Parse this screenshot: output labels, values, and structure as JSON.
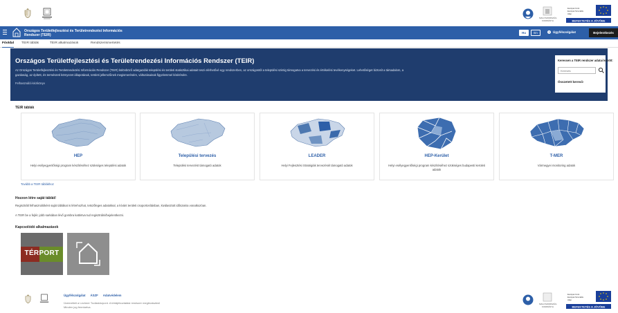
{
  "header": {
    "ministry_logo_text": "MINISZTÉRIUM",
    "eu_partner_text": "MAGYARORSZÁG KORMÁNYA",
    "eu_flag_text": "Európai Unió Európai Szociális Alap",
    "eu_slogan": "BEFEKTETÉS A JÖVŐBE"
  },
  "titlebar": {
    "app_title_line1": "Országos Területfejlesztési és Területrendezési Információs",
    "app_title_line2": "Rendszer (TEIR)",
    "lang_hu": "Hu",
    "lang_en": "En",
    "help_label": "Ügyfélszolgálat",
    "login_label": "Bejelentkezés",
    "accent_color": "#2d5fa8"
  },
  "nav": {
    "tabs": [
      {
        "label": "Főoldal",
        "active": true
      },
      {
        "label": "TEIR táblák",
        "active": false
      },
      {
        "label": "TEIR alkalmazások",
        "active": false
      },
      {
        "label": "Rendszerismertetés",
        "active": false
      }
    ]
  },
  "hero": {
    "title": "Országos Területfejlesztési és Területrendezési Információs Rendszer (TEIR)",
    "desc_line1": "Az Országos Területfejlesztési és Területrendezési Információs Rendszer (TEIR) különböző adatgazdák települési és területi statisztikai adatait teszi elérhetővé egy rendszerben, az országostól a települési szintig támogatva a tervezési és értékelési tevékenységeket. Lehetőséget biztosít a társadalom, a",
    "desc_line2": "gazdaság, az épített, és természeti környezet állapotának, területi jellemzőinek megismerésére, változásainak figyelemmel kísérésére.",
    "manual_link": "Felhasználói kézikönyv",
    "search_title": "Keressen a TEIR rendszer adatai között:",
    "search_placeholder": "Keresés",
    "advanced_search": "Összetett kereső›"
  },
  "teir_tables": {
    "section_title": "TEIR táblák",
    "cards": [
      {
        "title": "HEP",
        "desc": "Helyi esélyegyenlőségi program készítéséhez szükséges települési adatok"
      },
      {
        "title": "Települési tervezés",
        "desc": "Települési tervezést támogató adatok"
      },
      {
        "title": "LEADER",
        "desc": "Helyi Fejlesztési Stratégiák tervezését támogató adatok"
      },
      {
        "title": "HEP-Kerület",
        "desc": "Helyi esélyegyenlőségi program készítéséhez szükséges budapesti kerületi adatok"
      },
      {
        "title": "T-MER",
        "desc": "Vármegyei monitoring adatok"
      }
    ],
    "more_link": "Tovább a TEIR táblákhoz"
  },
  "own_table": {
    "title": "Hozzon létre saját táblát!",
    "line1": "Regisztrált felhasználóként saját táblákat is létrehozhat, tetszőleges adatokkal, a kívánt területi csoportosításban, kiválasztott időszakra vonatkozóan.",
    "line2": "A TEIR be a fejléc jobb sarkában lévő gombra kattintva tud regisztrálni/bejelentkezni."
  },
  "apps": {
    "section_title": "Kapcsolódó alkalmazások",
    "terport_label": "TÉRPORT"
  },
  "footer": {
    "links": [
      "Ügyfélszolgálat",
      "ÁSZF",
      "Adatvédelem"
    ],
    "note_line1": "Üzemelteti a Lechner Tudásközpont. A tértájékoztatási rendszer megbízásából",
    "note_line2": "Minden jog fenntartva."
  }
}
